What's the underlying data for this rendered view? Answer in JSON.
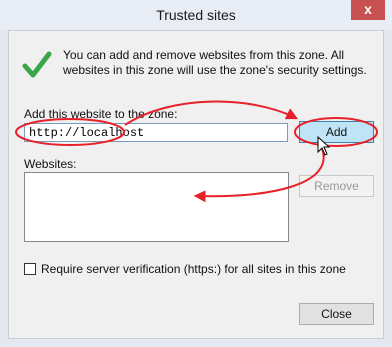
{
  "window": {
    "title": "Trusted sites",
    "close_glyph": "x"
  },
  "info": {
    "text": "You can add and remove websites from this zone. All websites in this zone will use the zone's security settings."
  },
  "add_field": {
    "label": "Add this website to the zone:",
    "value": "http://localhost"
  },
  "buttons": {
    "add": "Add",
    "remove": "Remove",
    "close": "Close"
  },
  "websites": {
    "label": "Websites:",
    "items": []
  },
  "https_option": {
    "label": "Require server verification (https:) for all sites in this zone",
    "checked": false
  },
  "annotation": {
    "color": "#e8202a"
  },
  "icons": {
    "info_icon": "green-check-icon",
    "cursor": "mouse-cursor-icon"
  }
}
